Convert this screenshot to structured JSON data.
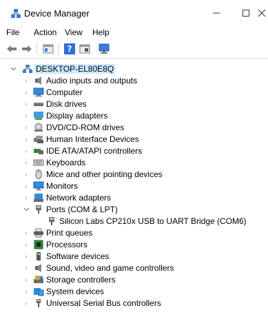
{
  "window": {
    "title": "Device Manager",
    "controls": {
      "minimize": "—",
      "maximize": "☐",
      "close": "✕"
    }
  },
  "menubar": [
    "File",
    "Action",
    "View",
    "Help"
  ],
  "toolbar": {
    "buttons": [
      "back-icon",
      "forward-icon",
      "properties-icon",
      "help-icon",
      "console-icon",
      "scan-icon"
    ]
  },
  "tree": {
    "root": {
      "label": "DESKTOP-EL80E8Q",
      "expanded": true
    },
    "categories": [
      {
        "label": "Audio inputs and outputs",
        "icon": "speaker-icon",
        "expanded": false
      },
      {
        "label": "Computer",
        "icon": "computer-icon",
        "expanded": false
      },
      {
        "label": "Disk drives",
        "icon": "disk-icon",
        "expanded": false
      },
      {
        "label": "Display adapters",
        "icon": "display-icon",
        "expanded": false
      },
      {
        "label": "DVD/CD-ROM drives",
        "icon": "dvd-icon",
        "expanded": false
      },
      {
        "label": "Human Interface Devices",
        "icon": "hid-icon",
        "expanded": false
      },
      {
        "label": "IDE ATA/ATAPI controllers",
        "icon": "ide-icon",
        "expanded": false
      },
      {
        "label": "Keyboards",
        "icon": "keyboard-icon",
        "expanded": false
      },
      {
        "label": "Mice and other pointing devices",
        "icon": "mouse-icon",
        "expanded": false
      },
      {
        "label": "Monitors",
        "icon": "monitor-icon",
        "expanded": false
      },
      {
        "label": "Network adapters",
        "icon": "network-icon",
        "expanded": false
      },
      {
        "label": "Ports (COM & LPT)",
        "icon": "port-icon",
        "expanded": true,
        "children": [
          {
            "label": "Silicon Labs CP210x USB to UART Bridge (COM6)",
            "icon": "port-icon"
          }
        ]
      },
      {
        "label": "Print queues",
        "icon": "printer-icon",
        "expanded": false
      },
      {
        "label": "Processors",
        "icon": "processor-icon",
        "expanded": false
      },
      {
        "label": "Software devices",
        "icon": "software-icon",
        "expanded": false
      },
      {
        "label": "Sound, video and game controllers",
        "icon": "sound-icon",
        "expanded": false
      },
      {
        "label": "Storage controllers",
        "icon": "storage-icon",
        "expanded": false
      },
      {
        "label": "System devices",
        "icon": "system-icon",
        "expanded": false
      },
      {
        "label": "Universal Serial Bus controllers",
        "icon": "usb-icon",
        "expanded": false
      }
    ]
  },
  "colors": {
    "selection": "#cce8ff",
    "chevron": "#8a8a8a",
    "accent": "#1e73d2"
  }
}
